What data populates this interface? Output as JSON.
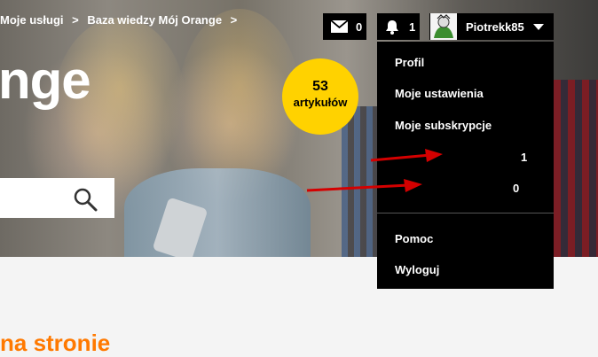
{
  "breadcrumb": {
    "items": [
      "Moje usługi",
      ">",
      "Baza wiedzy Mój Orange",
      ">"
    ]
  },
  "hero": {
    "title_fragment": "nge"
  },
  "badge": {
    "count": "53",
    "label": "artykułów"
  },
  "search": {
    "value": "",
    "placeholder": ""
  },
  "header": {
    "messages_count": "0",
    "notifications_count": "1",
    "username": "Piotrekk85"
  },
  "user_menu": {
    "items": [
      {
        "label": "Profil"
      },
      {
        "label": "Moje ustawienia"
      },
      {
        "label": "Moje subskrypcje"
      }
    ],
    "counts": [
      "1",
      "0"
    ],
    "bottom_items": [
      {
        "label": "Pomoc"
      },
      {
        "label": "Wyloguj"
      }
    ]
  },
  "section": {
    "title_fragment": "na stronie"
  },
  "icons": [
    "envelope-icon",
    "bell-icon",
    "search-icon",
    "chevron-down-icon",
    "avatar-image",
    "red-arrow"
  ],
  "colors": {
    "accent": "#ff7900",
    "badge": "#ffd200",
    "menu_bg": "#000000",
    "arrow": "#d40000"
  }
}
